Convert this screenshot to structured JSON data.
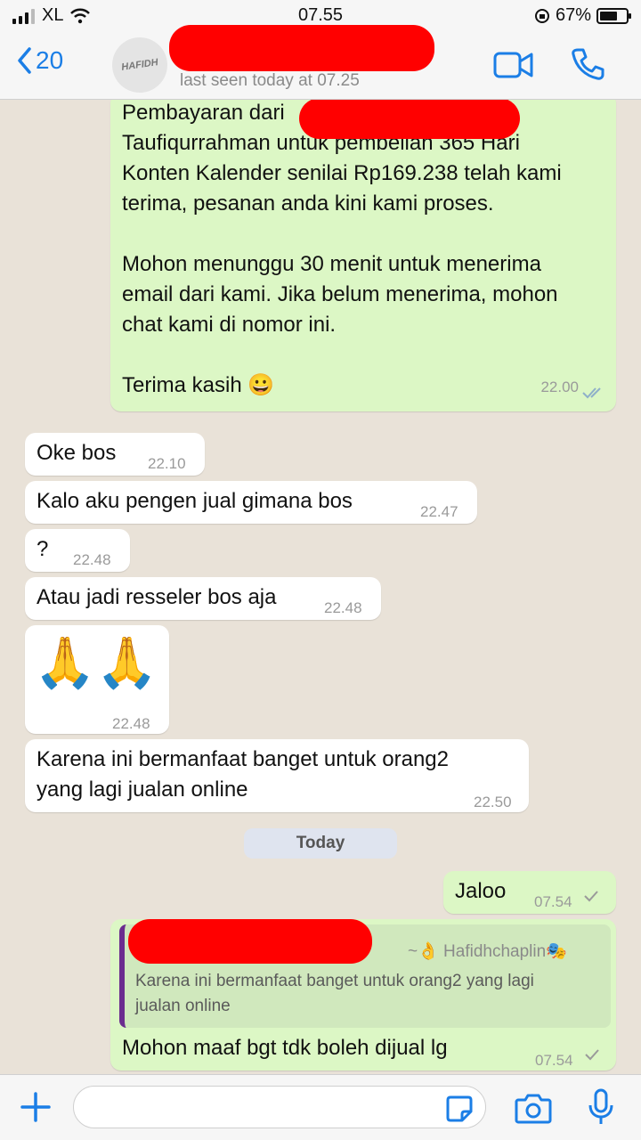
{
  "status_bar": {
    "carrier": "XL",
    "time": "07.55",
    "battery_percent": "67%",
    "battery_level": 0.67
  },
  "header": {
    "back_count": "20",
    "avatar_text": "HAFIDH",
    "last_seen": "last seen today at 07.25"
  },
  "messages": [
    {
      "direction": "out",
      "lines": [
        "Pembayaran dari",
        "Taufiqurrahman untuk pembelian 365 Hari",
        "Konten Kalender senilai Rp169.238 telah kami",
        "terima, pesanan anda kini kami proses.",
        "",
        "Mohon menunggu 30 menit untuk menerima",
        "email dari kami. Jika belum menerima, mohon",
        "chat kami di nomor ini.",
        "",
        "Terima kasih 😀"
      ],
      "time": "22.00",
      "status": "read"
    },
    {
      "direction": "in",
      "text": "Oke bos",
      "time": "22.10"
    },
    {
      "direction": "in",
      "text": "Kalo aku pengen jual gimana bos",
      "time": "22.47"
    },
    {
      "direction": "in",
      "text": "?",
      "time": "22.48"
    },
    {
      "direction": "in",
      "text": "Atau jadi resseler bos aja",
      "time": "22.48"
    },
    {
      "direction": "in",
      "text": "🙏🙏",
      "time": "22.48"
    },
    {
      "direction": "in",
      "lines": [
        "Karena ini bermanfaat banget untuk orang2",
        "yang lagi jualan online"
      ],
      "time": "22.50"
    },
    {
      "direction": "out",
      "text": "Jaloo",
      "time": "07.54"
    },
    {
      "direction": "out",
      "quote": {
        "sender": "~👌 Hafidhchaplin🎭",
        "lines": [
          "Karena ini bermanfaat banget untuk orang2 yang lagi",
          "jualan online"
        ]
      },
      "text": "Mohon maaf bgt tdk boleh dijual lg",
      "time": "07.54"
    }
  ],
  "day_separator": "Today",
  "input": {
    "value": ""
  },
  "colors": {
    "accent": "#1b7ee6",
    "outgoing_bubble": "#dcf7c5",
    "incoming_bubble": "#ffffff",
    "chat_background": "#e9e2d8",
    "redaction": "#ff0000"
  },
  "icons": [
    "chevron-left-icon",
    "video-call-icon",
    "phone-icon",
    "plus-icon",
    "sticker-icon",
    "camera-icon",
    "microphone-icon",
    "double-check-icon",
    "single-check-icon"
  ]
}
